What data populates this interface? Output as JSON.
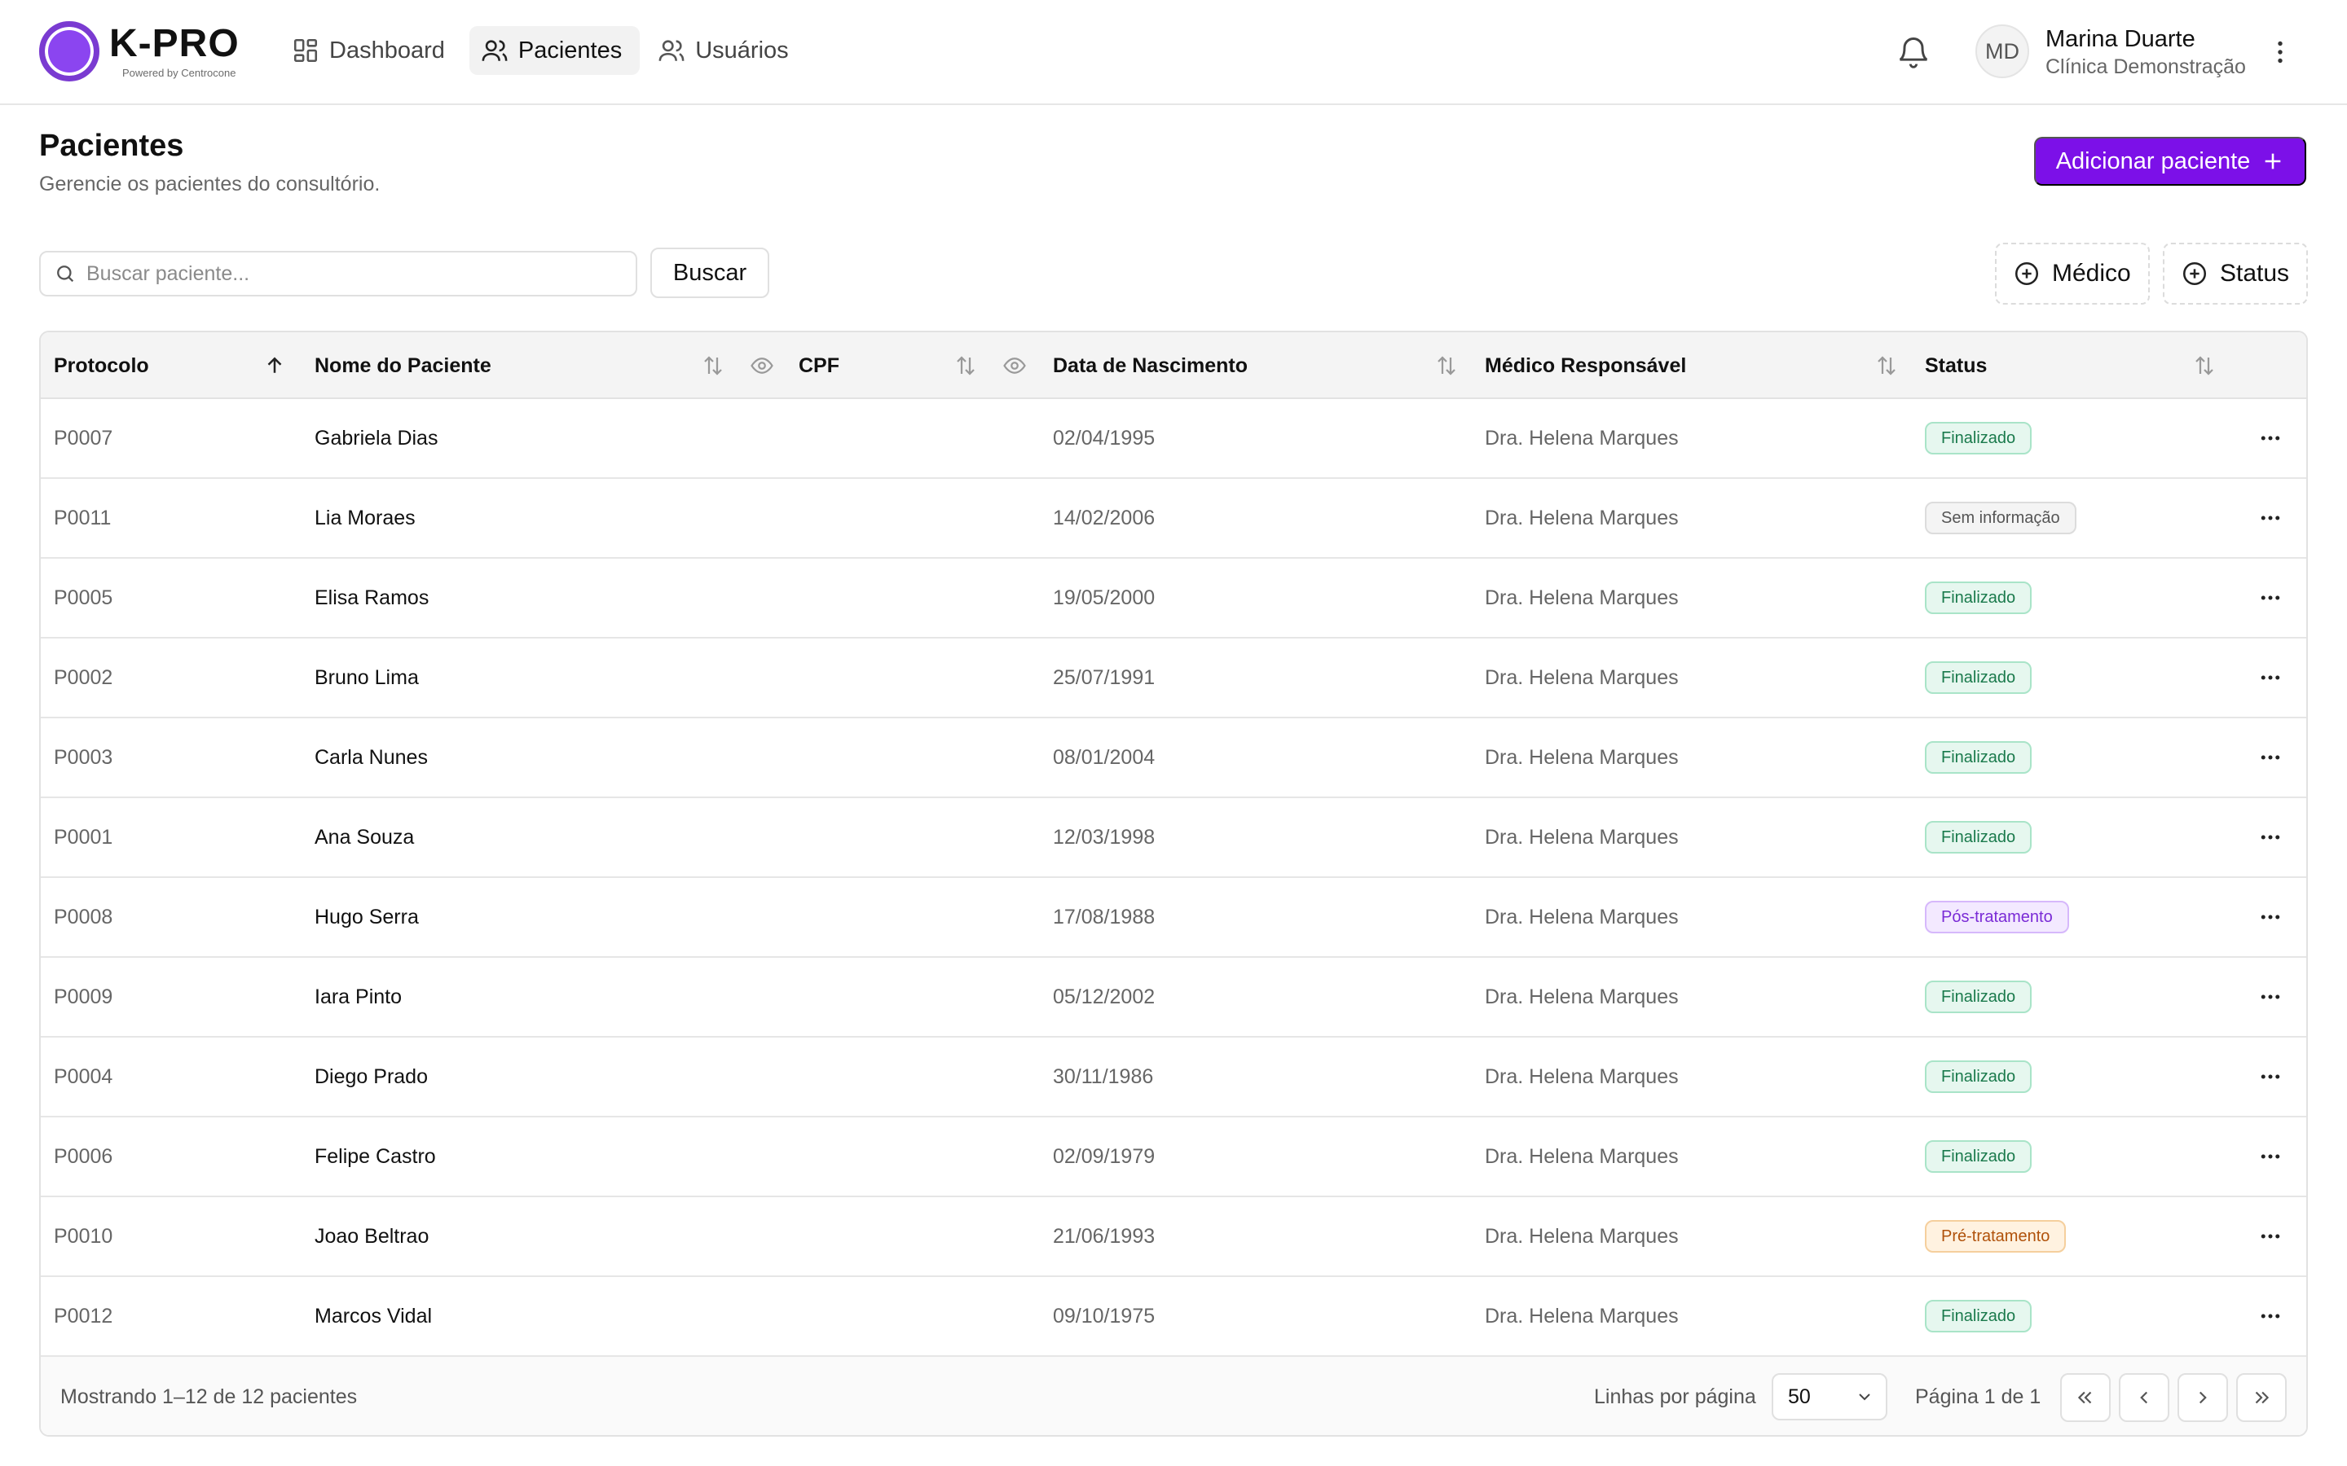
{
  "app": {
    "logo_title": "K-PRO",
    "logo_subtitle": "Powered by Centrocone",
    "accent": "#7c10e8"
  },
  "nav": {
    "items": [
      {
        "label": "Dashboard",
        "icon": "dashboard-icon",
        "active": false
      },
      {
        "label": "Pacientes",
        "icon": "users-icon",
        "active": true
      },
      {
        "label": "Usuários",
        "icon": "users-icon",
        "active": false
      }
    ]
  },
  "user": {
    "initials": "MD",
    "name": "Marina Duarte",
    "org": "Clínica Demonstração"
  },
  "page": {
    "title": "Pacientes",
    "subtitle": "Gerencie os pacientes do consultório.",
    "add_button": "Adicionar paciente"
  },
  "toolbar": {
    "search_placeholder": "Buscar paciente...",
    "search_button": "Buscar",
    "filter_medico": "Médico",
    "filter_status": "Status"
  },
  "table": {
    "columns": [
      "Protocolo",
      "Nome do Paciente",
      "CPF",
      "Data de Nascimento",
      "Médico Responsável",
      "Status"
    ],
    "rows": [
      {
        "protocol": "P0007",
        "name": "Gabriela Dias",
        "cpf": "",
        "birth": "02/04/1995",
        "doctor": "Dra. Helena Marques",
        "status": "Finalizado",
        "status_kind": "fin"
      },
      {
        "protocol": "P0011",
        "name": "Lia Moraes",
        "cpf": "",
        "birth": "14/02/2006",
        "doctor": "Dra. Helena Marques",
        "status": "Sem informação",
        "status_kind": "sem"
      },
      {
        "protocol": "P0005",
        "name": "Elisa Ramos",
        "cpf": "",
        "birth": "19/05/2000",
        "doctor": "Dra. Helena Marques",
        "status": "Finalizado",
        "status_kind": "fin"
      },
      {
        "protocol": "P0002",
        "name": "Bruno Lima",
        "cpf": "",
        "birth": "25/07/1991",
        "doctor": "Dra. Helena Marques",
        "status": "Finalizado",
        "status_kind": "fin"
      },
      {
        "protocol": "P0003",
        "name": "Carla Nunes",
        "cpf": "",
        "birth": "08/01/2004",
        "doctor": "Dra. Helena Marques",
        "status": "Finalizado",
        "status_kind": "fin"
      },
      {
        "protocol": "P0001",
        "name": "Ana Souza",
        "cpf": "",
        "birth": "12/03/1998",
        "doctor": "Dra. Helena Marques",
        "status": "Finalizado",
        "status_kind": "fin"
      },
      {
        "protocol": "P0008",
        "name": "Hugo Serra",
        "cpf": "",
        "birth": "17/08/1988",
        "doctor": "Dra. Helena Marques",
        "status": "Pós-tratamento",
        "status_kind": "pos"
      },
      {
        "protocol": "P0009",
        "name": "Iara Pinto",
        "cpf": "",
        "birth": "05/12/2002",
        "doctor": "Dra. Helena Marques",
        "status": "Finalizado",
        "status_kind": "fin"
      },
      {
        "protocol": "P0004",
        "name": "Diego Prado",
        "cpf": "",
        "birth": "30/11/1986",
        "doctor": "Dra. Helena Marques",
        "status": "Finalizado",
        "status_kind": "fin"
      },
      {
        "protocol": "P0006",
        "name": "Felipe Castro",
        "cpf": "",
        "birth": "02/09/1979",
        "doctor": "Dra. Helena Marques",
        "status": "Finalizado",
        "status_kind": "fin"
      },
      {
        "protocol": "P0010",
        "name": "Joao Beltrao",
        "cpf": "",
        "birth": "21/06/1993",
        "doctor": "Dra. Helena Marques",
        "status": "Pré-tratamento",
        "status_kind": "pre"
      },
      {
        "protocol": "P0012",
        "name": "Marcos Vidal",
        "cpf": "",
        "birth": "09/10/1975",
        "doctor": "Dra. Helena Marques",
        "status": "Finalizado",
        "status_kind": "fin"
      }
    ]
  },
  "footer": {
    "count_text": "Mostrando 1–12 de 12 pacientes",
    "rows_per_page_label": "Linhas por página",
    "rows_per_page_value": "50",
    "page_text": "Página 1 de 1"
  }
}
